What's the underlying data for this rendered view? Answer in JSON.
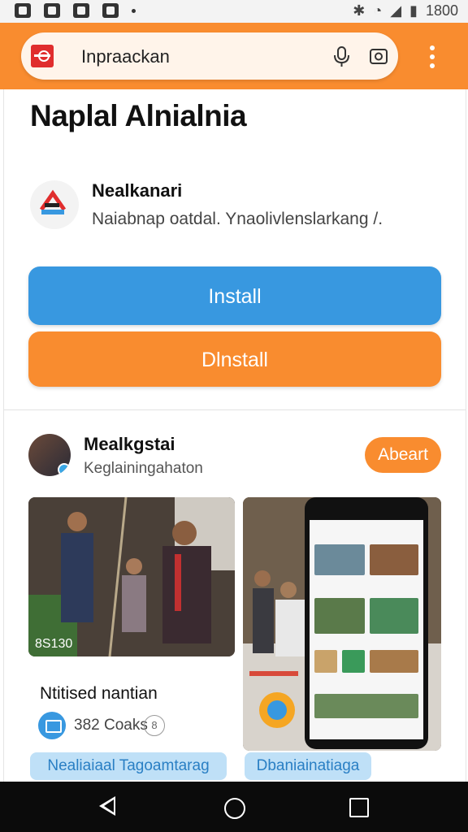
{
  "status_bar": {
    "time": "1800"
  },
  "browser": {
    "url_text": "Inpraackan"
  },
  "page": {
    "title": "Naplal Alnialnia",
    "app": {
      "name": "Nealkanari",
      "description": "Naiabnap oatdal. Ynaolivlenslarkang /."
    },
    "buttons": {
      "install": "Install",
      "uninstall": "Dlnstall"
    }
  },
  "channel": {
    "name": "Mealkgstai",
    "subtitle": "Keglainingahaton",
    "about_label": "Abeart"
  },
  "cards": [
    {
      "image_label": "8S130",
      "title": "Ntitised nantian",
      "meta": "382 Coaks",
      "badge": "8",
      "tag": "Nealiaiaal Tagoamtarag"
    },
    {
      "tag": "Dbaniainatiaga"
    }
  ],
  "colors": {
    "accent_orange": "#f98c2f",
    "accent_blue": "#3898e0",
    "chip_blue": "#bfe0f7"
  }
}
